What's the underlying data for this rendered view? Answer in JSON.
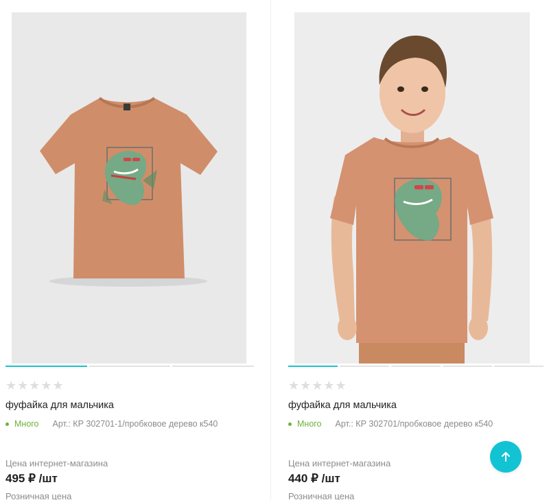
{
  "products": [
    {
      "stars": "★★★★★",
      "title": "фуфайка для мальчика",
      "stock": "Много",
      "article": "Арт.: КР 302701-1/пробковое дерево к540",
      "price_label": "Цена интернет-магазина",
      "price": "495 ₽ /шт",
      "retail_label": "Розничная цена",
      "gallery_pages": 3,
      "gallery_active": 1
    },
    {
      "stars": "★★★★★",
      "title": "фуфайка для мальчика",
      "stock": "Много",
      "article": "Арт.: КР 302701/пробковое дерево к540",
      "price_label": "Цена интернет-магазина",
      "price": "440 ₽ /шт",
      "retail_label": "Розничная цена",
      "gallery_pages": 5,
      "gallery_active": 1
    }
  ],
  "colors": {
    "accent": "#19c2c9",
    "stock": "#6bb23a",
    "shirt": "#cf8e69",
    "print": "#76a985"
  },
  "icons": {
    "scroll_top": "arrow-up-icon",
    "rating": "star-icon"
  }
}
